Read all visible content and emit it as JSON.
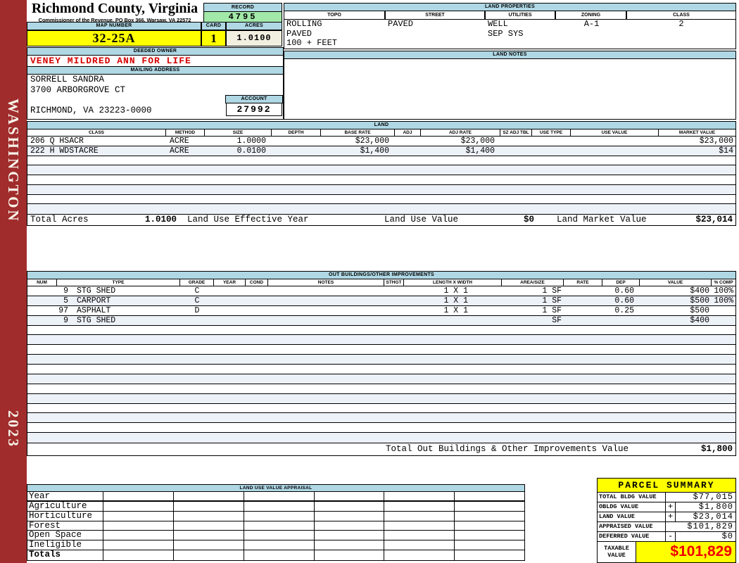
{
  "sidebar": {
    "county": "WASHINGTON",
    "year": "2023"
  },
  "header": {
    "title": "Richmond County, Virginia",
    "subtitle": "Commissioner of the Revenue, PO Box 366, Warsaw, VA 22572",
    "record_label": "RECORD",
    "record_value": "4795",
    "map_number_label": "MAP NUMBER",
    "map_number_value": "32-25A",
    "card_label": "CARD",
    "card_value": "1",
    "acres_label": "ACRES",
    "acres_value": "1.0100"
  },
  "land_properties": {
    "title": "LAND PROPERTIES",
    "columns": [
      "TOPO",
      "STREET",
      "UTILITIES",
      "ZONING",
      "CLASS"
    ],
    "topo_lines": [
      "ROLLING",
      "PAVED",
      "100 + FEET"
    ],
    "street": "PAVED",
    "utilities_lines": [
      "WELL",
      "SEP SYS"
    ],
    "zoning": "A-1",
    "class": "2"
  },
  "land_notes": {
    "title": "LAND NOTES"
  },
  "owner": {
    "deeded_owner_label": "DEEDED OWNER",
    "deeded_owner": "VENEY MILDRED ANN FOR LIFE",
    "mailing_address_label": "MAILING ADDRESS",
    "address_lines": [
      "SORRELL SANDRA",
      "3700 ARBORGROVE CT",
      "",
      "RICHMOND, VA 23223-0000"
    ],
    "account_label": "ACCOUNT",
    "account_value": "27992"
  },
  "land": {
    "title": "LAND",
    "columns": [
      "CLASS",
      "METHOD",
      "SIZE",
      "DEPTH",
      "BASE RATE",
      "ADJ",
      "ADJ RATE",
      "SZ ADJ TBL",
      "USE TYPE",
      "USE VALUE",
      "MARKET VALUE"
    ],
    "rows": [
      {
        "class": "206 Q HSACR",
        "method": "ACRE",
        "size": "1.0000",
        "base_rate": "$23,000",
        "adj_rate": "$23,000",
        "market_value": "$23,000"
      },
      {
        "class": "222 H WDSTACRE",
        "method": "ACRE",
        "size": "0.0100",
        "base_rate": "$1,400",
        "adj_rate": "$1,400",
        "market_value": "$14"
      }
    ],
    "empty_row_count": 6,
    "totals": {
      "total_acres_label": "Total Acres",
      "total_acres": "1.0100",
      "effective_year_label": "Land Use Effective Year",
      "use_value_label": "Land Use Value",
      "use_value": "$0",
      "market_label": "Land Market Value",
      "market_value": "$23,014"
    }
  },
  "out_buildings": {
    "title": "OUT BUILDINGS/OTHER IMPROVEMENTS",
    "columns": [
      "NUM",
      "TYPE",
      "GRADE",
      "YEAR",
      "COND",
      "NOTES",
      "STHGT",
      "LENGTH X WIDTH",
      "AREA/SIZE",
      "RATE",
      "DEP",
      "VALUE",
      "% COMP"
    ],
    "rows": [
      {
        "num": "9",
        "type": "STG SHED",
        "grade": "C",
        "length_width": "1 X 1",
        "area_size": "1 SF",
        "dep": "0.60",
        "value": "$400",
        "pct_comp": "100%"
      },
      {
        "num": "5",
        "type": "CARPORT",
        "grade": "C",
        "length_width": "1 X 1",
        "area_size": "1 SF",
        "dep": "0.60",
        "value": "$500",
        "pct_comp": "100%"
      },
      {
        "num": "97",
        "type": "ASPHALT",
        "grade": "D",
        "length_width": "1 X 1",
        "area_size": "1 SF",
        "dep": "0.25",
        "value": "$500",
        "pct_comp": ""
      },
      {
        "num": "9",
        "type": "STG SHED",
        "grade": "",
        "length_width": "",
        "area_size": "SF",
        "dep": "",
        "value": "$400",
        "pct_comp": ""
      }
    ],
    "empty_row_count": 12,
    "total_label": "Total Out Buildings & Other Improvements Value",
    "total_value": "$1,800"
  },
  "land_use_appraisal": {
    "title": "LAND USE VALUE APPRAISAL",
    "row_labels": [
      "Year",
      "Agriculture",
      "Horticulture",
      "Forest",
      "Open Space",
      "Ineligible",
      "Totals"
    ],
    "data_column_count": 6
  },
  "parcel_summary": {
    "title": "PARCEL SUMMARY",
    "rows": [
      {
        "label": "TOTAL BLDG VALUE",
        "op": "",
        "value": "$77,015"
      },
      {
        "label": "OBLDG VALUE",
        "op": "+",
        "value": "$1,800"
      },
      {
        "label": "LAND VALUE",
        "op": "+",
        "value": "$23,014"
      },
      {
        "label": "APPRAISED VALUE",
        "op": "",
        "value": "$101,829"
      },
      {
        "label": "DEFERRED VALUE",
        "op": "-",
        "value": "$0"
      }
    ],
    "taxable_label": "TAXABLE VALUE",
    "taxable_value": "$101,829"
  },
  "colors": {
    "sidebar_red": "#A02C2C",
    "header_blue": "#AFD7E4",
    "highlight_yellow": "#FFFF00",
    "record_green": "#A2E8A8",
    "acres_cream": "#F1EFDF",
    "stripe_blue": "#EDF1F8",
    "owner_red": "#D40000",
    "taxable_red": "#F00000"
  }
}
